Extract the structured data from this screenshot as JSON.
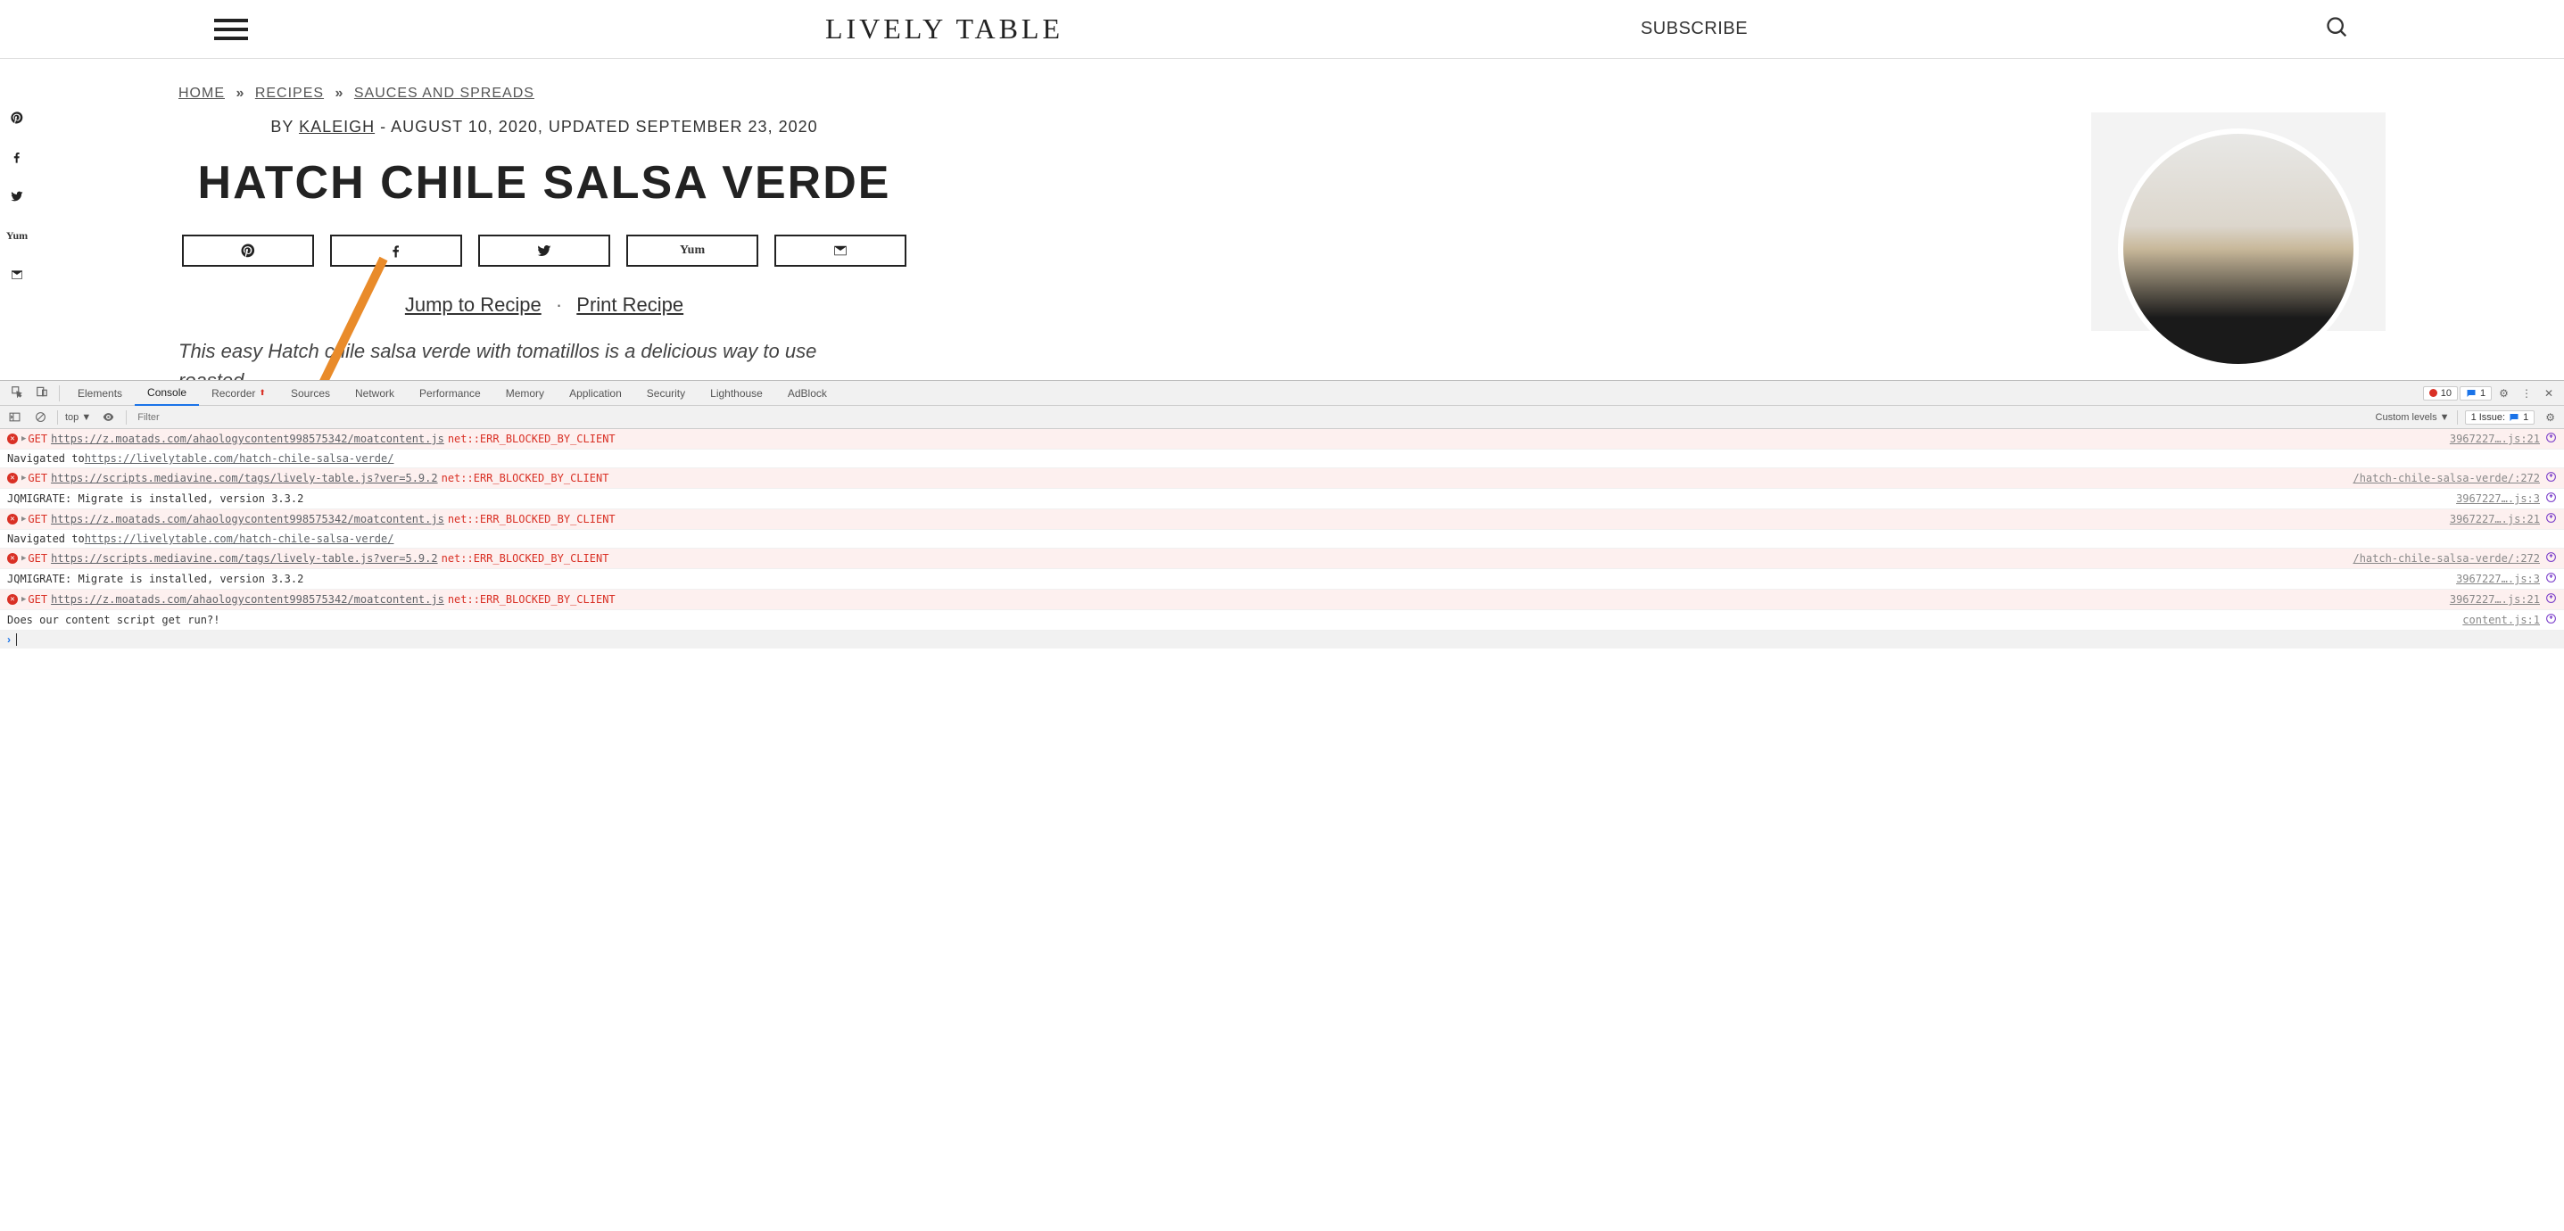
{
  "header": {
    "logo": "LIVELY TABLE",
    "subscribe": "SUBSCRIBE"
  },
  "breadcrumb": {
    "home": "HOME",
    "recipes": "RECIPES",
    "category": "SAUCES AND SPREADS"
  },
  "post": {
    "by_prefix": "BY ",
    "author": "KALEIGH",
    "date_line": " - AUGUST 10, 2020, UPDATED SEPTEMBER 23, 2020",
    "title": "HATCH CHILE SALSA VERDE",
    "jump": "Jump to Recipe",
    "print": "Print Recipe",
    "intro": "This easy Hatch chile salsa verde with tomatillos is a delicious way to use roasted"
  },
  "devtools": {
    "tabs": [
      "Elements",
      "Console",
      "Recorder",
      "Sources",
      "Network",
      "Performance",
      "Memory",
      "Application",
      "Security",
      "Lighthouse",
      "AdBlock"
    ],
    "active_tab": "Console",
    "error_count": "10",
    "msg_count": "1",
    "toolbar": {
      "context": "top ▼",
      "filter_placeholder": "Filter",
      "levels": "Custom levels ▼",
      "issues": "1 Issue:",
      "issues_count": "1"
    },
    "logs": [
      {
        "type": "err",
        "method": "GET",
        "url": "https://z.moatads.com/ahaologycontent998575342/moatcontent.js",
        "code": "net::ERR_BLOCKED_BY_CLIENT",
        "src": "3967227….js:21"
      },
      {
        "type": "nav",
        "prefix": "Navigated to ",
        "url": "https://livelytable.com/hatch-chile-salsa-verde/",
        "src": ""
      },
      {
        "type": "err",
        "method": "GET",
        "url": "https://scripts.mediavine.com/tags/lively-table.js?ver=5.9.2",
        "code": "net::ERR_BLOCKED_BY_CLIENT",
        "src": "/hatch-chile-salsa-verde/:272"
      },
      {
        "type": "log",
        "text": "JQMIGRATE: Migrate is installed, version 3.3.2",
        "src": "3967227….js:3"
      },
      {
        "type": "err",
        "method": "GET",
        "url": "https://z.moatads.com/ahaologycontent998575342/moatcontent.js",
        "code": "net::ERR_BLOCKED_BY_CLIENT",
        "src": "3967227….js:21"
      },
      {
        "type": "nav",
        "prefix": "Navigated to ",
        "url": "https://livelytable.com/hatch-chile-salsa-verde/",
        "src": ""
      },
      {
        "type": "err",
        "method": "GET",
        "url": "https://scripts.mediavine.com/tags/lively-table.js?ver=5.9.2",
        "code": "net::ERR_BLOCKED_BY_CLIENT",
        "src": "/hatch-chile-salsa-verde/:272"
      },
      {
        "type": "log",
        "text": "JQMIGRATE: Migrate is installed, version 3.3.2",
        "src": "3967227….js:3"
      },
      {
        "type": "err",
        "method": "GET",
        "url": "https://z.moatads.com/ahaologycontent998575342/moatcontent.js",
        "code": "net::ERR_BLOCKED_BY_CLIENT",
        "src": "3967227….js:21"
      },
      {
        "type": "log",
        "text": "Does our content script get run?!",
        "src": "content.js:1"
      }
    ]
  }
}
